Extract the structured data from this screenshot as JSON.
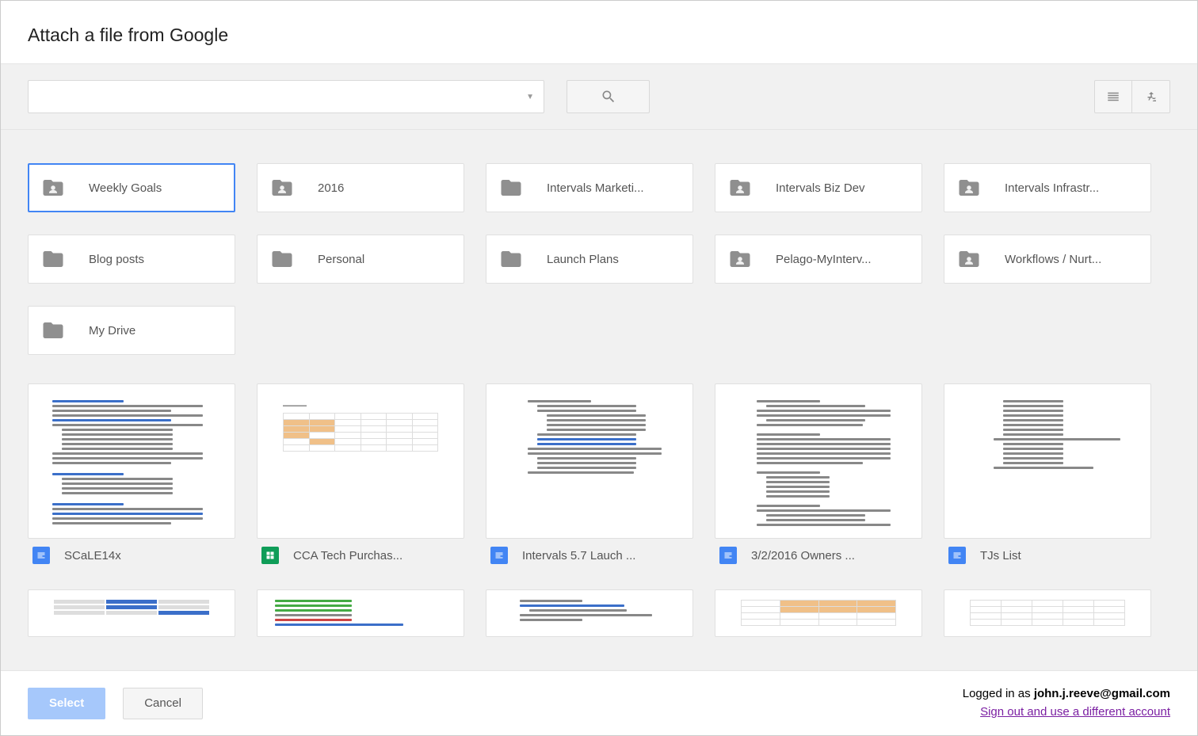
{
  "header": {
    "title": "Attach a file from Google"
  },
  "toolbar": {
    "search_value": "",
    "search_placeholder": ""
  },
  "folders": [
    {
      "name": "Weekly Goals",
      "shared": true,
      "selected": true
    },
    {
      "name": "2016",
      "shared": true,
      "selected": false
    },
    {
      "name": "Intervals Marketi...",
      "shared": false,
      "selected": false
    },
    {
      "name": "Intervals Biz Dev",
      "shared": true,
      "selected": false
    },
    {
      "name": "Intervals Infrastr...",
      "shared": true,
      "selected": false
    },
    {
      "name": "Blog posts",
      "shared": false,
      "selected": false
    },
    {
      "name": "Personal",
      "shared": false,
      "selected": false
    },
    {
      "name": "Launch Plans",
      "shared": false,
      "selected": false
    },
    {
      "name": "Pelago-MyInterv...",
      "shared": true,
      "selected": false
    },
    {
      "name": "Workflows / Nurt...",
      "shared": true,
      "selected": false
    },
    {
      "name": "My Drive",
      "shared": false,
      "selected": false
    }
  ],
  "files": [
    {
      "name": "SCaLE14x",
      "type": "doc"
    },
    {
      "name": "CCA Tech Purchas...",
      "type": "sheet"
    },
    {
      "name": "Intervals 5.7 Lauch ...",
      "type": "doc"
    },
    {
      "name": "3/2/2016 Owners ...",
      "type": "doc"
    },
    {
      "name": "TJs List",
      "type": "doc"
    }
  ],
  "footer": {
    "select_label": "Select",
    "cancel_label": "Cancel",
    "logged_in_prefix": "Logged in as ",
    "email": "john.j.reeve@gmail.com",
    "signout_label": "Sign out and use a different account"
  }
}
